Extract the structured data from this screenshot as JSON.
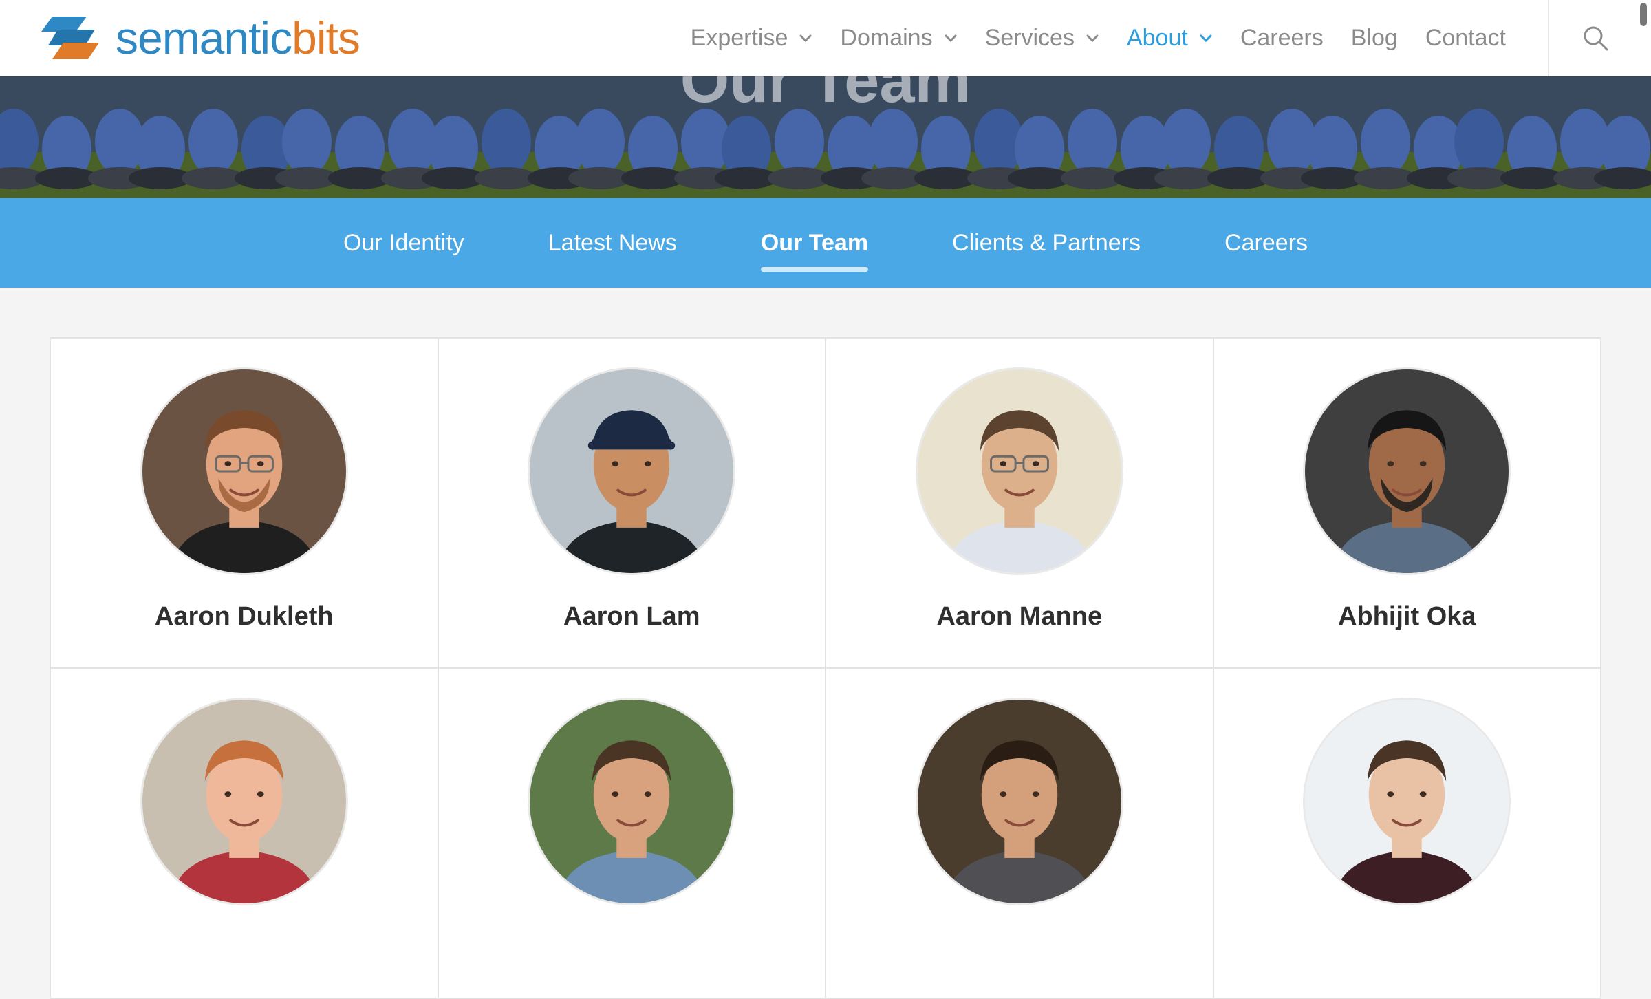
{
  "brand": {
    "part1": "semantic",
    "part2": "bits"
  },
  "colors": {
    "accent": "#2b9ee0",
    "subnav_bg": "#4aa8e6",
    "logo_blue": "#2d88c4",
    "logo_orange": "#e07b2a"
  },
  "nav": {
    "items": [
      {
        "label": "Expertise",
        "dropdown": true,
        "active": false
      },
      {
        "label": "Domains",
        "dropdown": true,
        "active": false
      },
      {
        "label": "Services",
        "dropdown": true,
        "active": false
      },
      {
        "label": "About",
        "dropdown": true,
        "active": true
      },
      {
        "label": "Careers",
        "dropdown": false,
        "active": false
      },
      {
        "label": "Blog",
        "dropdown": false,
        "active": false
      },
      {
        "label": "Contact",
        "dropdown": false,
        "active": false
      }
    ],
    "search_icon": "search-icon"
  },
  "hero": {
    "title": "Our Team"
  },
  "subnav": {
    "items": [
      {
        "label": "Our Identity",
        "active": false
      },
      {
        "label": "Latest News",
        "active": false
      },
      {
        "label": "Our Team",
        "active": true
      },
      {
        "label": "Clients & Partners",
        "active": false
      },
      {
        "label": "Careers",
        "active": false
      }
    ]
  },
  "team": [
    {
      "name": "Aaron Dukleth",
      "bg": "#6b5344",
      "skin": "#e2a47f",
      "hair": "#7a4a2c",
      "shirt": "#1f1f1f",
      "glasses": true,
      "beard": "#a0603a"
    },
    {
      "name": "Aaron Lam",
      "bg": "#b9c2c8",
      "skin": "#c98f63",
      "hair": "#1c2a44",
      "shirt": "#1e2427",
      "glasses": false,
      "cap": "#1c2a44"
    },
    {
      "name": "Aaron Manne",
      "bg": "#e8e2cf",
      "skin": "#ddb08c",
      "hair": "#5b4330",
      "shirt": "#dfe4ec",
      "glasses": true
    },
    {
      "name": "Abhijit Oka",
      "bg": "#3f3f3f",
      "skin": "#a06a48",
      "hair": "#161616",
      "shirt": "#5a6f86",
      "glasses": false,
      "beard": "#1b1b1b"
    },
    {
      "name": "",
      "bg": "#c9bfb0",
      "skin": "#efb89a",
      "hair": "#c5703d",
      "shirt": "#b4343d",
      "glasses": false
    },
    {
      "name": "",
      "bg": "#5d7a48",
      "skin": "#d9a27e",
      "hair": "#4a3524",
      "shirt": "#6c8fb3",
      "glasses": false
    },
    {
      "name": "",
      "bg": "#4a3d2d",
      "skin": "#d4a07c",
      "hair": "#2a1d14",
      "shirt": "#505054",
      "glasses": false
    },
    {
      "name": "",
      "bg": "#eef1f4",
      "skin": "#e9c2a6",
      "hair": "#4a3426",
      "shirt": "#3d1e24",
      "glasses": false
    }
  ]
}
